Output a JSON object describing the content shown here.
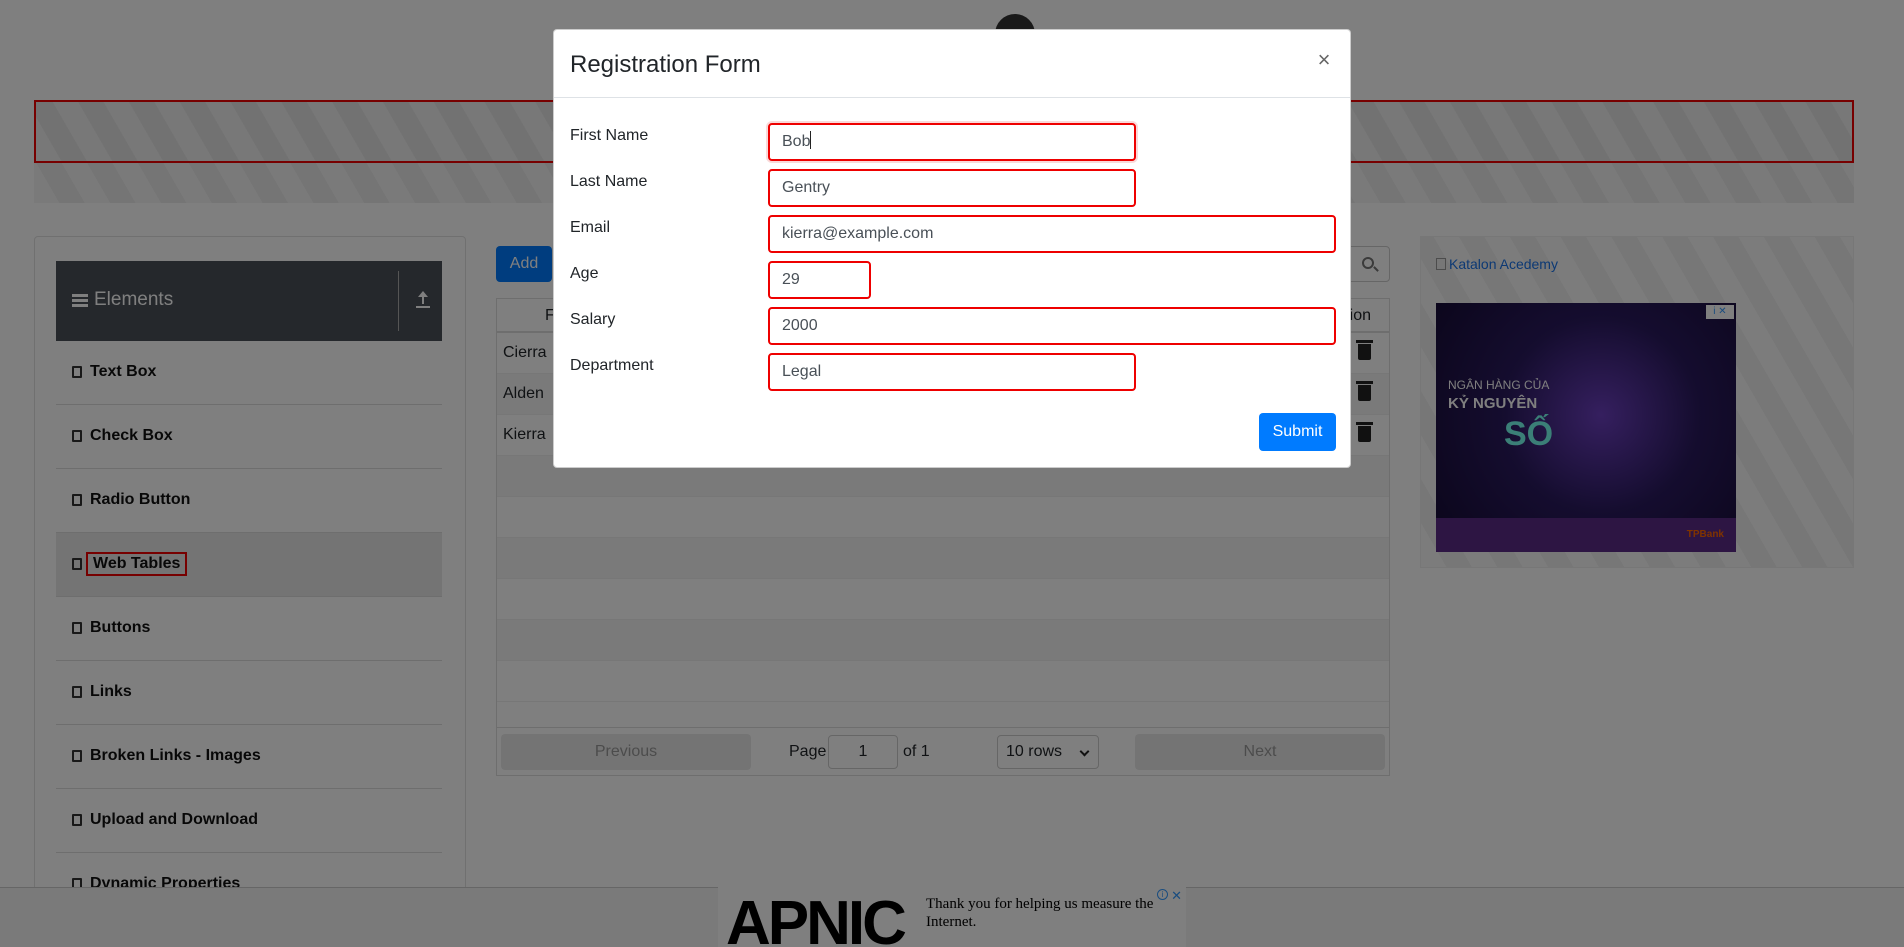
{
  "sidebar": {
    "group_title": "Elements",
    "items": [
      {
        "label": "Text Box"
      },
      {
        "label": "Check Box"
      },
      {
        "label": "Radio Button"
      },
      {
        "label": "Web Tables"
      },
      {
        "label": "Buttons"
      },
      {
        "label": "Links"
      },
      {
        "label": "Broken Links - Images"
      },
      {
        "label": "Upload and Download"
      },
      {
        "label": "Dynamic Properties"
      }
    ],
    "active_item": "Web Tables"
  },
  "toolbar": {
    "add_label": "Add"
  },
  "table": {
    "header_first": "F",
    "header_action": "ion",
    "rows": [
      {
        "first_name": "Cierra"
      },
      {
        "first_name": "Alden"
      },
      {
        "first_name": "Kierra"
      }
    ]
  },
  "pagination": {
    "previous_label": "Previous",
    "page_label": "Page",
    "page_value": "1",
    "of_label": "of 1",
    "rows_select": "10 rows",
    "next_label": "Next"
  },
  "right_ad": {
    "link_text": "Katalon Acedemy",
    "image_lines": [
      "NGÂN HÀNG CỦA",
      "KỶ NGUYÊN",
      "SỐ"
    ],
    "brand": "TPBank"
  },
  "bottom_ad": {
    "brand": "APNIC",
    "message": "Thank you for helping us measure the Internet."
  },
  "modal": {
    "title": "Registration Form",
    "close_label": "×",
    "fields": {
      "first_name": {
        "label": "First Name",
        "value": "Bob"
      },
      "last_name": {
        "label": "Last Name",
        "value": "Gentry"
      },
      "email": {
        "label": "Email",
        "value": "kierra@example.com"
      },
      "age": {
        "label": "Age",
        "value": "29"
      },
      "salary": {
        "label": "Salary",
        "value": "2000"
      },
      "department": {
        "label": "Department",
        "value": "Legal"
      }
    },
    "submit_label": "Submit"
  },
  "colors": {
    "primary": "#007bff",
    "validation_error": "#ee0000",
    "sidebar_header": "#4a5058"
  }
}
